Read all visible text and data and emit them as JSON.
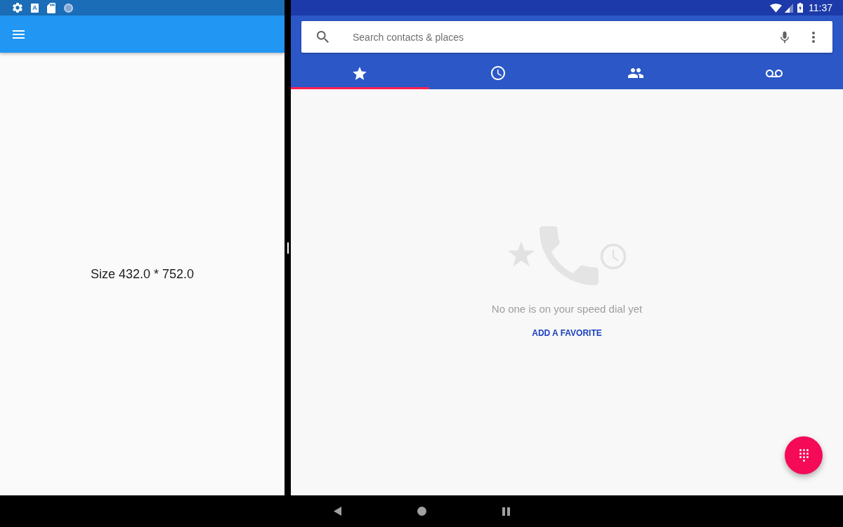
{
  "left_app": {
    "status_bar": {
      "app_icon_letter": "A"
    },
    "body_text": "Size 432.0 * 752.0"
  },
  "dialer": {
    "status_bar": {
      "time": "11:37"
    },
    "search": {
      "placeholder": "Search contacts & places"
    },
    "tabs": [
      {
        "kind": "favorites",
        "selected": true
      },
      {
        "kind": "recents",
        "selected": false
      },
      {
        "kind": "contacts",
        "selected": false
      },
      {
        "kind": "voicemail",
        "selected": false
      }
    ],
    "empty_state": {
      "message": "No one is on your speed dial yet",
      "action": "ADD A FAVORITE"
    }
  }
}
